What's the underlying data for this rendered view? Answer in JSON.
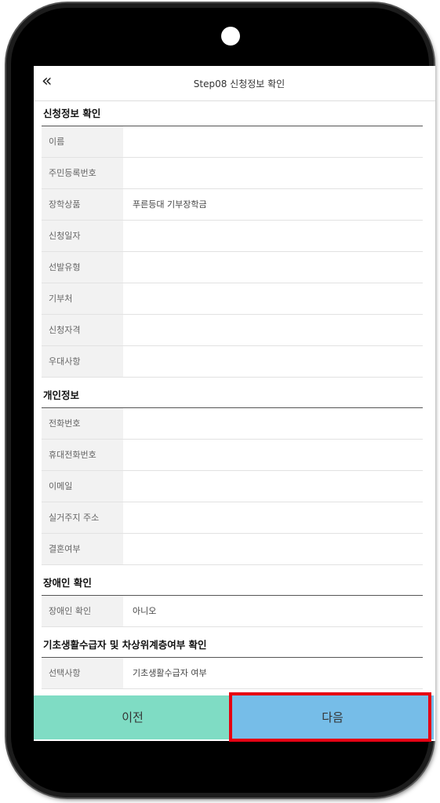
{
  "header": {
    "back_icon": "«",
    "title": "Step08 신청정보 확인"
  },
  "sections": {
    "application": {
      "title": "신청정보 확인",
      "rows": [
        {
          "label": "이름",
          "value": ""
        },
        {
          "label": "주민등록번호",
          "value": ""
        },
        {
          "label": "장학상품",
          "value": "푸른등대 기부장학금"
        },
        {
          "label": "신청일자",
          "value": ""
        },
        {
          "label": "선발유형",
          "value": ""
        },
        {
          "label": "기부처",
          "value": ""
        },
        {
          "label": "신청자격",
          "value": ""
        },
        {
          "label": "우대사항",
          "value": ""
        }
      ]
    },
    "personal": {
      "title": "개인정보",
      "rows": [
        {
          "label": "전화번호",
          "value": ""
        },
        {
          "label": "휴대전화번호",
          "value": ""
        },
        {
          "label": "이메일",
          "value": ""
        },
        {
          "label": "실거주지 주소",
          "value": ""
        },
        {
          "label": "결혼여부",
          "value": ""
        }
      ]
    },
    "disability": {
      "title": "장애인 확인",
      "rows": [
        {
          "label": "장애인 확인",
          "value": "아니오"
        }
      ]
    },
    "basic_living": {
      "title": "기초생활수급자 및 차상위계층여부 확인",
      "rows": [
        {
          "label": "선택사항",
          "value": "기초생활수급자 여부"
        }
      ]
    }
  },
  "buttons": {
    "prev": "이전",
    "next": "다음"
  },
  "colors": {
    "prev_button": "#7fdcc4",
    "next_button": "#76bde8",
    "highlight_border": "#e60012"
  }
}
